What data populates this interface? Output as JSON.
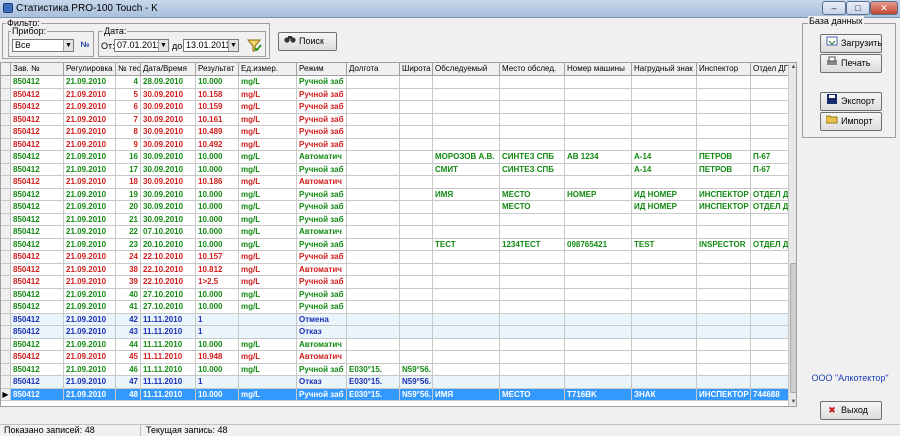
{
  "window": {
    "title": "Статистика PRO-100 Touch - K",
    "minimize": "–",
    "maximize": "□",
    "close": "✕"
  },
  "filter": {
    "label": "Фильтр:",
    "device": {
      "label": "Прибор:",
      "value": "Все"
    },
    "device_btn": "№",
    "date": {
      "label": "Дата:",
      "from_label": "От:",
      "from": "07.01.2011",
      "to_label": "до:",
      "to": "13.01.2011"
    },
    "apply_icon": "filter-check-icon",
    "search_label": "Поиск",
    "combo_arrow": "▼"
  },
  "database": {
    "label": "База данных",
    "load_label": "Загрузить",
    "print_label": "Печать",
    "export_label": "Экспорт",
    "import_label": "Импорт"
  },
  "company": "ООО \"Алкотектор\"",
  "exit_label": "Выход",
  "grid": {
    "columns": [
      "Зав. №",
      "Регулировка",
      "№ тест",
      "Дата/Время",
      "Результат",
      "Ед.измер.",
      "Режим",
      "Долгота",
      "Широта",
      "Обследуемый",
      "Место обслед.",
      "Номер машины",
      "Нагрудный знак",
      "Инспектор",
      "Отдел ДПС"
    ],
    "rows": [
      [
        "850412",
        "21.09.2010",
        "4",
        "28.09.2010",
        "10.000",
        "mg/L",
        "Ручной заб",
        "",
        "",
        "",
        "",
        "",
        "",
        "",
        ""
      ],
      [
        "850412",
        "21.09.2010",
        "5",
        "30.09.2010",
        "10.158",
        "mg/L",
        "Ручной заб",
        "",
        "",
        "",
        "",
        "",
        "",
        "",
        ""
      ],
      [
        "850412",
        "21.09.2010",
        "6",
        "30.09.2010",
        "10.159",
        "mg/L",
        "Ручной заб",
        "",
        "",
        "",
        "",
        "",
        "",
        "",
        ""
      ],
      [
        "850412",
        "21.09.2010",
        "7",
        "30.09.2010",
        "10.161",
        "mg/L",
        "Ручной заб",
        "",
        "",
        "",
        "",
        "",
        "",
        "",
        ""
      ],
      [
        "850412",
        "21.09.2010",
        "8",
        "30.09.2010",
        "10.489",
        "mg/L",
        "Ручной заб",
        "",
        "",
        "",
        "",
        "",
        "",
        "",
        ""
      ],
      [
        "850412",
        "21.09.2010",
        "9",
        "30.09.2010",
        "10.492",
        "mg/L",
        "Ручной заб",
        "",
        "",
        "",
        "",
        "",
        "",
        "",
        ""
      ],
      [
        "850412",
        "21.09.2010",
        "16",
        "30.09.2010",
        "10.000",
        "mg/L",
        "Автоматич",
        "",
        "",
        "МОРОЗОВ А.В.",
        "СИНТЕЗ СПБ",
        "АВ 1234",
        "А-14",
        "ПЕТРОВ",
        "П-67"
      ],
      [
        "850412",
        "21.09.2010",
        "17",
        "30.09.2010",
        "10.000",
        "mg/L",
        "Ручной заб",
        "",
        "",
        "СМИТ",
        "СИНТЕЗ СПБ",
        "",
        "А-14",
        "ПЕТРОВ",
        "П-67"
      ],
      [
        "850412",
        "21.09.2010",
        "18",
        "30.09.2010",
        "10.186",
        "mg/L",
        "Автоматич",
        "",
        "",
        "",
        "",
        "",
        "",
        "",
        ""
      ],
      [
        "850412",
        "21.09.2010",
        "19",
        "30.09.2010",
        "10.000",
        "mg/L",
        "Ручной заб",
        "",
        "",
        "ИМЯ",
        "МЕСТО",
        "НОМЕР",
        "ИД НОМЕР",
        "ИНСПЕКТОР",
        "ОТДЕЛ ДПС"
      ],
      [
        "850412",
        "21.09.2010",
        "20",
        "30.09.2010",
        "10.000",
        "mg/L",
        "Ручной заб",
        "",
        "",
        "",
        "МЕСТО",
        "",
        "ИД НОМЕР",
        "ИНСПЕКТОР",
        "ОТДЕЛ ДПС"
      ],
      [
        "850412",
        "21.09.2010",
        "21",
        "30.09.2010",
        "10.000",
        "mg/L",
        "Ручной заб",
        "",
        "",
        "",
        "",
        "",
        "",
        "",
        ""
      ],
      [
        "850412",
        "21.09.2010",
        "22",
        "07.10.2010",
        "10.000",
        "mg/L",
        "Автоматич",
        "",
        "",
        "",
        "",
        "",
        "",
        "",
        ""
      ],
      [
        "850412",
        "21.09.2010",
        "23",
        "20.10.2010",
        "10.000",
        "mg/L",
        "Ручной заб",
        "",
        "",
        "ТЕСТ",
        "1234ТЕСТ",
        "098765421",
        "TEST",
        "INSPECTOR",
        "ОТДЕЛ ДПС"
      ],
      [
        "850412",
        "21.09.2010",
        "24",
        "22.10.2010",
        "10.157",
        "mg/L",
        "Ручной заб",
        "",
        "",
        "",
        "",
        "",
        "",
        "",
        ""
      ],
      [
        "850412",
        "21.09.2010",
        "38",
        "22.10.2010",
        "10.812",
        "mg/L",
        "Автоматич",
        "",
        "",
        "",
        "",
        "",
        "",
        "",
        ""
      ],
      [
        "850412",
        "21.09.2010",
        "39",
        "22.10.2010",
        "1>2.5",
        "mg/L",
        "Ручной заб",
        "",
        "",
        "",
        "",
        "",
        "",
        "",
        ""
      ],
      [
        "850412",
        "21.09.2010",
        "40",
        "27.10.2010",
        "10.000",
        "mg/L",
        "Ручной заб",
        "",
        "",
        "",
        "",
        "",
        "",
        "",
        ""
      ],
      [
        "850412",
        "21.09.2010",
        "41",
        "27.10.2010",
        "10.000",
        "mg/L",
        "Ручной заб",
        "",
        "",
        "",
        "",
        "",
        "",
        "",
        ""
      ],
      [
        "850412",
        "21.09.2010",
        "42",
        "11.11.2010",
        "1",
        "",
        "Отмена",
        "",
        "",
        "",
        "",
        "",
        "",
        "",
        ""
      ],
      [
        "850412",
        "21.09.2010",
        "43",
        "11.11.2010",
        "1",
        "",
        "Отказ",
        "",
        "",
        "",
        "",
        "",
        "",
        "",
        ""
      ],
      [
        "850412",
        "21.09.2010",
        "44",
        "11.11.2010",
        "10.000",
        "mg/L",
        "Автоматич",
        "",
        "",
        "",
        "",
        "",
        "",
        "",
        ""
      ],
      [
        "850412",
        "21.09.2010",
        "45",
        "11.11.2010",
        "10.948",
        "mg/L",
        "Автоматич",
        "",
        "",
        "",
        "",
        "",
        "",
        "",
        ""
      ],
      [
        "850412",
        "21.09.2010",
        "46",
        "11.11.2010",
        "10.000",
        "mg/L",
        "Ручной заб",
        "E030°15.",
        "N59°56.",
        "",
        "",
        "",
        "",
        "",
        ""
      ],
      [
        "850412",
        "21.09.2010",
        "47",
        "11.11.2010",
        "1",
        "",
        "Отказ",
        "E030°15.",
        "N59°56.",
        "",
        "",
        "",
        "",
        "",
        ""
      ],
      [
        "850412",
        "21.09.2010",
        "48",
        "11.11.2010",
        "10.000",
        "mg/L",
        "Ручной заб",
        "E030°15.",
        "N59°56.",
        "ИМЯ",
        "МЕСТО",
        "T716BK",
        "ЗНАК",
        "ИНСПЕКТОР",
        "744688"
      ]
    ],
    "row_colors": [
      "green",
      "red",
      "red",
      "red",
      "red",
      "red",
      "green",
      "green",
      "red",
      "green",
      "green",
      "green",
      "green",
      "green",
      "red",
      "red",
      "red",
      "green",
      "green",
      "blue",
      "blue",
      "green",
      "red",
      "green",
      "blue",
      "selected"
    ],
    "row_indicator": "▶"
  },
  "status": {
    "shown": "Показано записей: 48",
    "current": "Текущая запись: 48"
  }
}
